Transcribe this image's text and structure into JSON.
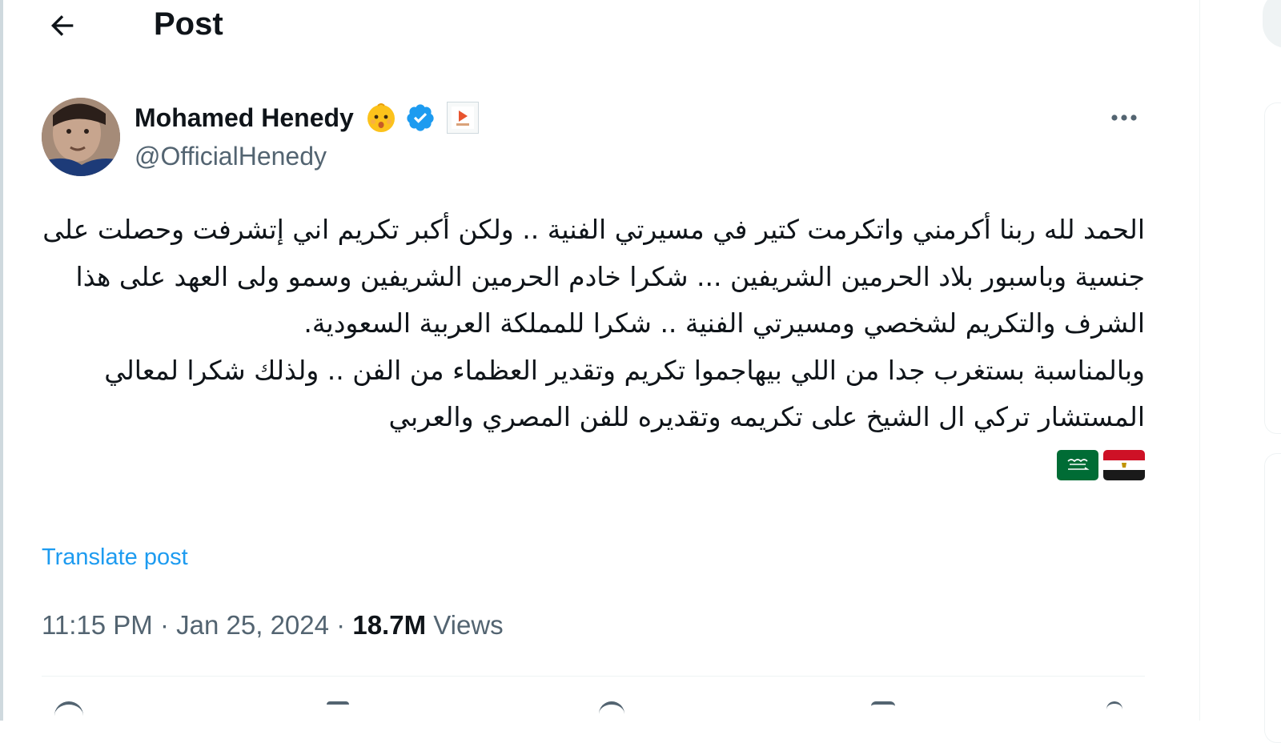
{
  "header": {
    "title": "Post",
    "back_icon": "arrow-left-icon"
  },
  "author": {
    "name": "Mohamed Henedy",
    "handle": "@OfficialHenedy",
    "emoji_badge": "baby-face-emoji",
    "verified": true,
    "verified_color": "#1d9bf0",
    "affiliate_badge": "affiliate-logo-icon"
  },
  "post": {
    "paragraph1": "الحمد لله ربنا أكرمني واتكرمت كتير في مسيرتي الفنية .. ولكن أكبر تكريم اني إتشرفت وحصلت على جنسية وباسبور بلاد الحرمين الشريفين ... شكرا خادم الحرمين الشريفين وسمو ولى العهد على هذا الشرف والتكريم لشخصي ومسيرتي الفنية .. شكرا للمملكة العربية السعودية.",
    "paragraph2": "وبالمناسبة بستغرب جدا من اللي بيهاجموا تكريم وتقدير العظماء من الفن .. ولذلك شكرا لمعالي المستشار تركي ال الشيخ على تكريمه وتقديره للفن المصري والعربي",
    "flags": [
      "egypt-flag",
      "saudi-arabia-flag"
    ],
    "translate_label": "Translate post"
  },
  "meta": {
    "time": "11:15 PM",
    "separator": "·",
    "date": "Jan 25, 2024",
    "views_count": "18.7M",
    "views_label": "Views"
  },
  "colors": {
    "text_primary": "#0f1419",
    "text_secondary": "#536471",
    "link": "#1d9bf0",
    "border": "#eff3f4"
  }
}
